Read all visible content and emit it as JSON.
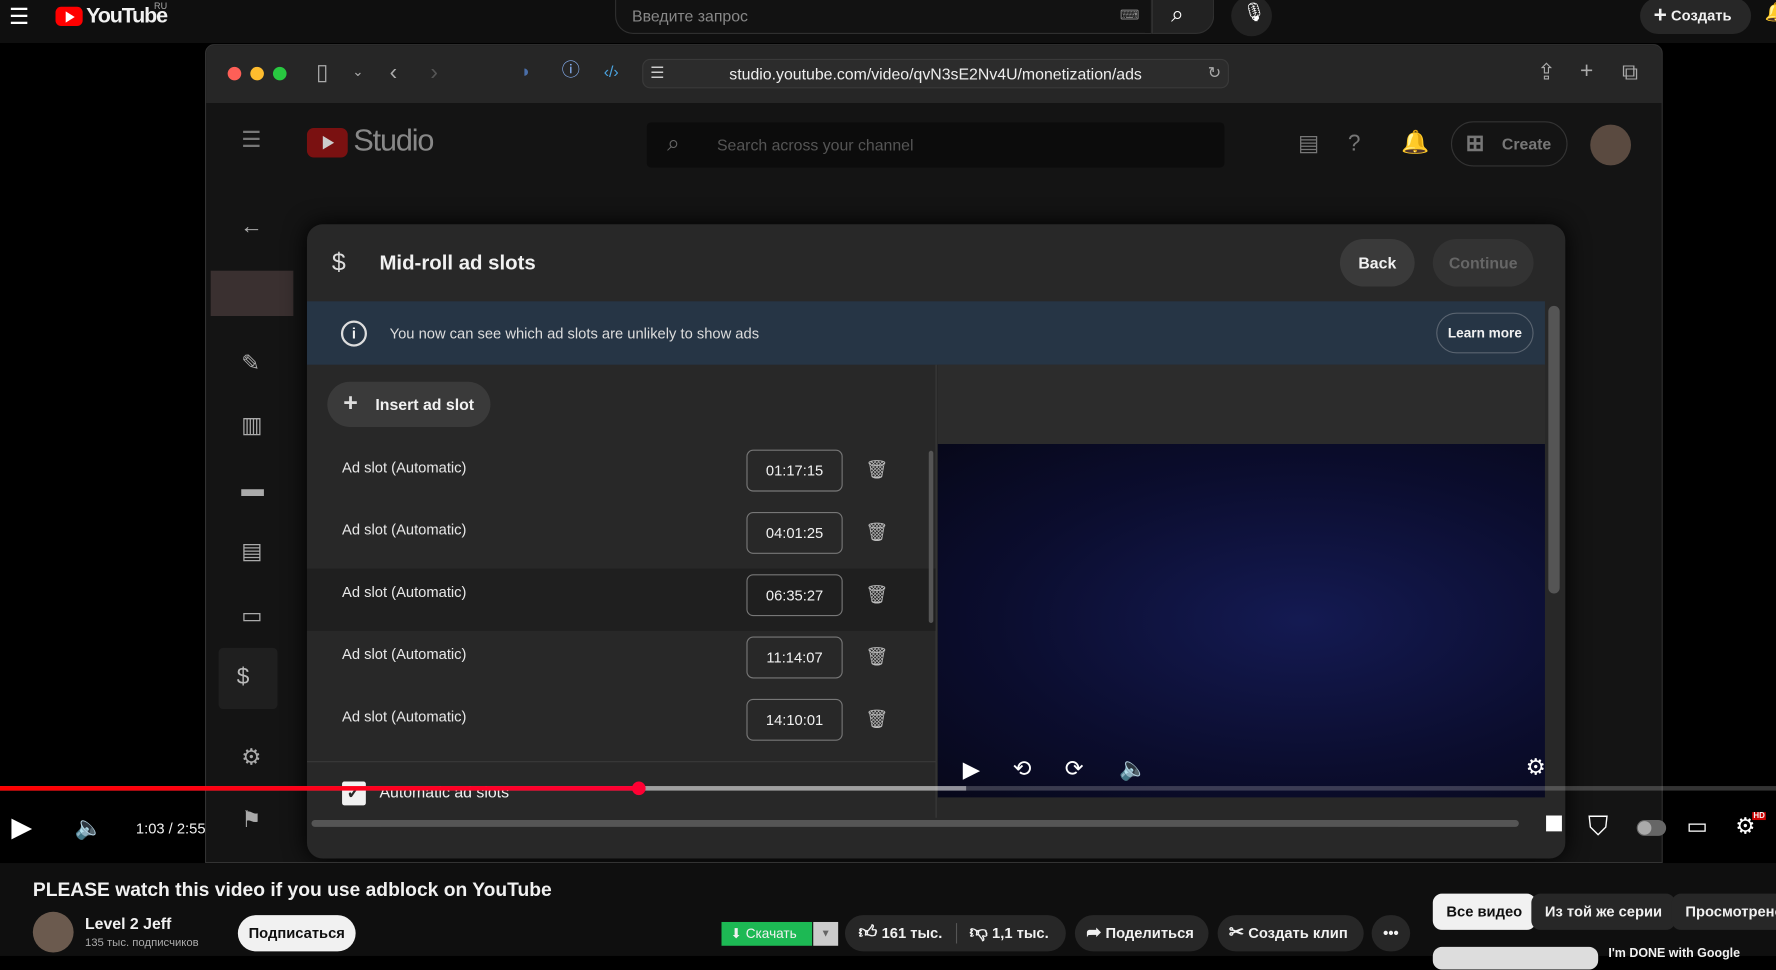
{
  "yt_header": {
    "logo": "YouTube",
    "region": "RU",
    "search_placeholder": "Введите запрос",
    "create_label": "Создать"
  },
  "browser": {
    "url": "studio.youtube.com/video/qvN3sE2Nv4U/monetization/ads"
  },
  "studio": {
    "logo": "Studio",
    "search_placeholder": "Search across your channel",
    "create_label": "Create"
  },
  "dialog": {
    "title": "Mid-roll ad slots",
    "back_label": "Back",
    "continue_label": "Continue",
    "banner_text": "You now can see which ad slots are unlikely to show ads",
    "learn_more_label": "Learn more",
    "insert_label": "Insert ad slot",
    "slots": [
      {
        "label": "Ad slot (Automatic)",
        "time": "01:17:15"
      },
      {
        "label": "Ad slot (Automatic)",
        "time": "04:01:25"
      },
      {
        "label": "Ad slot (Automatic)",
        "time": "06:35:27"
      },
      {
        "label": "Ad slot (Automatic)",
        "time": "11:14:07"
      },
      {
        "label": "Ad slot (Automatic)",
        "time": "14:10:01"
      }
    ],
    "auto_label": "Automatic ad slots",
    "auto_checked": true
  },
  "player": {
    "time": "1:03 / 2:55",
    "progress": 0.36,
    "buffered": 0.544,
    "hd_badge": "HD"
  },
  "video": {
    "title": "PLEASE watch this video if you use adblock on YouTube",
    "channel": "Level 2 Jeff",
    "subscribers": "135 тыс. подписчиков",
    "subscribe_label": "Подписаться",
    "download_label": "Скачать",
    "likes": "161 тыс.",
    "dislikes": "1,1 тыс.",
    "share_label": "Поделиться",
    "clip_label": "Создать клип"
  },
  "chips": [
    "Все видео",
    "Из той же серии",
    "Просмотрено"
  ],
  "next_video_title": "I'm DONE with Google"
}
